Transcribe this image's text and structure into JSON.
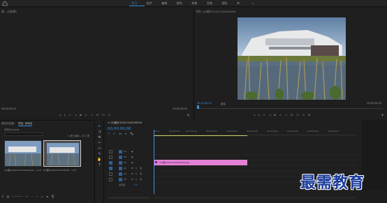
{
  "menu": {
    "tabs": [
      "学习",
      "组件",
      "编辑",
      "颜色",
      "效果",
      "音频",
      "图形",
      "库",
      "»"
    ],
    "active_index": 0
  },
  "source_panel": {
    "title": "源：(无剪辑)",
    "timecode_left": "00;00;00;00",
    "timecode_right": "00;00;00;00"
  },
  "program_panel": {
    "title": "节目: QQ图片20201102045094",
    "timecode_left": "00;00;00;00",
    "fit": "适合",
    "timecode_right": "00;00;04;29"
  },
  "project_panel": {
    "tab_media_browser": "媒体浏览器",
    "tab_project": "项目: 未命名",
    "project_name": "未命名.prproj",
    "item_count": "1 项已选择，共 2 项",
    "thumbs": [
      {
        "label": "QQ图片20201102045094.jpg",
        "duration": "4;29"
      },
      {
        "label": "QQ图片20201102045094",
        "duration": "4;29"
      }
    ]
  },
  "timeline": {
    "sequence_tab": "QQ图片20201102045094",
    "timecode": "00;00;00;00",
    "ruler_ticks": [
      "00;00",
      "00;00;00;30",
      "00;00;01;00",
      "00;00;01;30",
      "00;00;02;00",
      "00;00;02;30",
      "00;00;03;00",
      "00;00;03;30",
      "00;00;04;00",
      "00;00;04;30"
    ],
    "tracks": [
      {
        "name": "V3"
      },
      {
        "name": "V2"
      },
      {
        "name": "V1"
      },
      {
        "name": "A1"
      },
      {
        "name": "A2"
      },
      {
        "name": "A3"
      },
      {
        "name": "主声道",
        "value": "0.0"
      }
    ],
    "clip_label": "QQ图片20201102045094.jpg"
  },
  "watermark": "最需教育"
}
